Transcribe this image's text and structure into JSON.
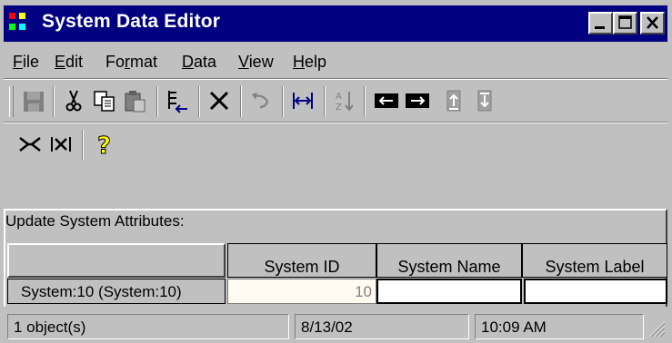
{
  "window": {
    "title": "System Data Editor"
  },
  "menu": [
    {
      "accel": "F",
      "rest": "ile"
    },
    {
      "accel": "E",
      "rest": "dit"
    },
    {
      "pre": "Fo",
      "accel": "r",
      "rest": "mat"
    },
    {
      "accel": "D",
      "rest": "ata"
    },
    {
      "accel": "V",
      "rest": "iew"
    },
    {
      "accel": "H",
      "rest": "elp"
    }
  ],
  "toolbar1_icons": [
    "save-icon",
    "cut-icon",
    "copy-icon",
    "paste-icon",
    "insert-column-icon",
    "delete-icon",
    "undo-icon",
    "fit-width-icon",
    "sort-icon",
    "move-left-icon",
    "move-right-icon",
    "move-up-icon",
    "move-down-icon"
  ],
  "toolbar2_icons": [
    "collapse-icon",
    "expand-icon",
    "help-icon"
  ],
  "panel": {
    "label": "Update System Attributes:"
  },
  "grid": {
    "columns": [
      "System ID",
      "System Name",
      "System Label"
    ],
    "rows": [
      {
        "header": "System:10 (System:10)",
        "system_id": "10",
        "system_name": "",
        "system_label": ""
      }
    ]
  },
  "status": {
    "count": "1 object(s)",
    "date": "8/13/02",
    "time": "10:09 AM"
  }
}
